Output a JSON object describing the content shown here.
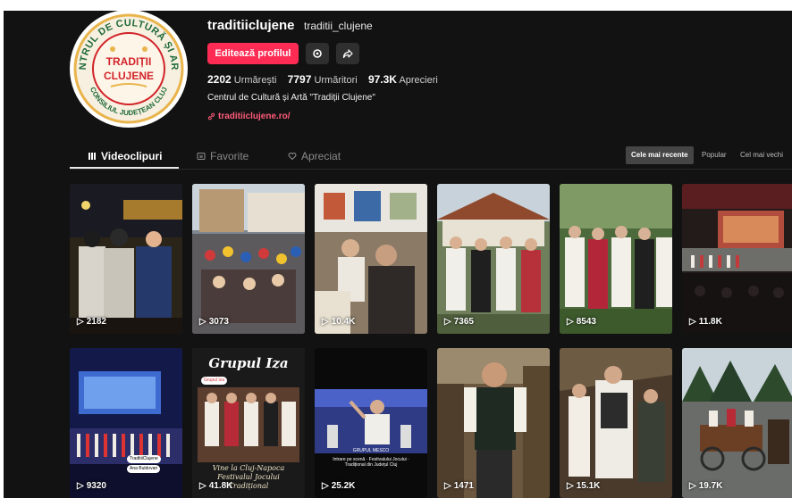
{
  "profile": {
    "username": "traditiiclujene",
    "handle": "traditii_clujene",
    "edit_label": "Editează profilul",
    "following_count": "2202",
    "following_label": "Urmărești",
    "followers_count": "7797",
    "followers_label": "Urmăritori",
    "likes_count": "97.3K",
    "likes_label": "Aprecieri",
    "bio": "Centrul de Cultură și Artă \"Tradiții Clujene\"",
    "link": "traditiiclujene.ro/"
  },
  "logo": {
    "top_text": "CENTRUL DE CULTURĂ ȘI ARTĂ",
    "line1": "TRADIȚII",
    "line2": "CLUJENE",
    "bottom_text": "CONSILIUL JUDEȚEAN CLUJ"
  },
  "tabs": [
    {
      "label": "Videoclipuri",
      "icon": "grid-icon"
    },
    {
      "label": "Favorite",
      "icon": "bookmark-icon"
    },
    {
      "label": "Apreciat",
      "icon": "heart-icon"
    }
  ],
  "sort": [
    {
      "label": "Cele mai recente",
      "active": true
    },
    {
      "label": "Popular",
      "active": false
    },
    {
      "label": "Cel mai vechi",
      "active": false
    }
  ],
  "videos": [
    {
      "views": "2182"
    },
    {
      "views": "3073"
    },
    {
      "views": "10.4K"
    },
    {
      "views": "7365"
    },
    {
      "views": "8543"
    },
    {
      "views": "11.8K"
    },
    {
      "views": "9320",
      "chip1": "TraditiiClujene",
      "chip2": "Ana Buldovan"
    },
    {
      "views": "41.8K",
      "title": "Grupul Iza",
      "chip": "Grupul Iza",
      "caption1": "Vine la Cluj-Napoca",
      "caption2": "Festivalul Jocului",
      "caption3": "Tradițional"
    },
    {
      "views": "25.2K",
      "top": "GRUPUL MESCO",
      "lines": "Intrare pe scenă · Festivalului Jocului · Tradițional din Județul Cluj"
    },
    {
      "views": "1471"
    },
    {
      "views": "15.1K"
    },
    {
      "views": "19.7K"
    }
  ],
  "colors": {
    "background": "#121212",
    "accent": "#fe2c55",
    "link": "#ff5c7a",
    "logo_red": "#d2232a",
    "logo_gold": "#e9b44c"
  }
}
